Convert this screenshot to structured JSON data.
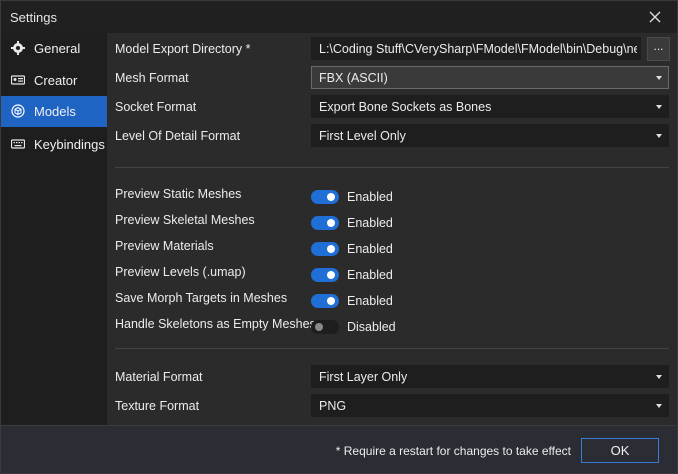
{
  "window": {
    "title": "Settings"
  },
  "sidebar": {
    "items": [
      {
        "label": "General",
        "icon": "gear-icon",
        "active": false
      },
      {
        "label": "Creator",
        "icon": "id-card-icon",
        "active": false
      },
      {
        "label": "Models",
        "icon": "cube-icon",
        "active": true
      },
      {
        "label": "Keybindings",
        "icon": "keyboard-icon",
        "active": false
      }
    ]
  },
  "models": {
    "export_dir": {
      "label": "Model Export Directory *",
      "value": "L:\\Coding Stuff\\CVerySharp\\FModel\\FModel\\bin\\Debug\\net",
      "browse_label": "..."
    },
    "mesh_format": {
      "label": "Mesh Format",
      "value": "FBX (ASCII)"
    },
    "socket_format": {
      "label": "Socket Format",
      "value": "Export Bone Sockets as Bones"
    },
    "lod_format": {
      "label": "Level Of Detail Format",
      "value": "First Level Only"
    },
    "toggles": [
      {
        "label": "Preview Static Meshes",
        "state": "Enabled",
        "on": true
      },
      {
        "label": "Preview Skeletal Meshes",
        "state": "Enabled",
        "on": true
      },
      {
        "label": "Preview Materials",
        "state": "Enabled",
        "on": true
      },
      {
        "label": "Preview Levels (.umap)",
        "state": "Enabled",
        "on": true
      },
      {
        "label": "Save Morph Targets in Meshes",
        "state": "Enabled",
        "on": true
      },
      {
        "label": "Handle Skeletons as Empty Meshes",
        "state": "Disabled",
        "on": false
      }
    ],
    "material_format": {
      "label": "Material Format",
      "value": "First Layer Only"
    },
    "texture_format": {
      "label": "Texture Format",
      "value": "PNG"
    }
  },
  "footer": {
    "note": "* Require a restart for changes to take effect",
    "ok_label": "OK"
  },
  "colors": {
    "accent": "#1f64c2",
    "toggle_on": "#1f6fd6"
  }
}
